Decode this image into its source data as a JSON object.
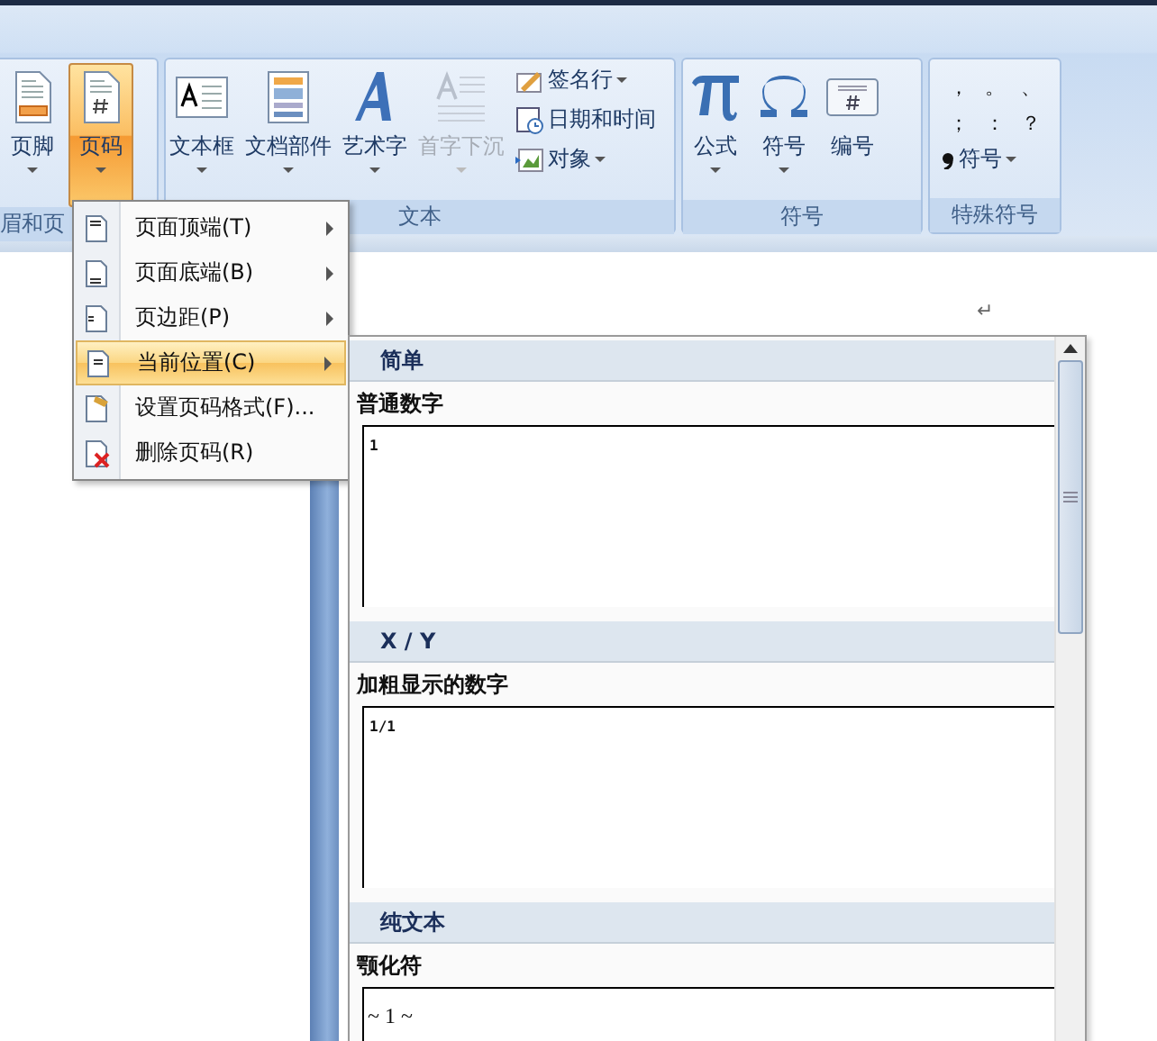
{
  "ribbon": {
    "groups": [
      {
        "label": "眉和页",
        "buttons": [
          {
            "kind": "footer",
            "label": "页脚",
            "dropdown": true,
            "selected": false,
            "disabled": false
          },
          {
            "kind": "page-number",
            "label": "页码",
            "dropdown": true,
            "selected": true,
            "disabled": false
          }
        ]
      },
      {
        "label": "文本",
        "buttons": [
          {
            "kind": "textbox",
            "label": "文本框",
            "dropdown": true,
            "selected": false,
            "disabled": false
          },
          {
            "kind": "quickparts",
            "label": "文档部件",
            "dropdown": true,
            "selected": false,
            "disabled": false
          },
          {
            "kind": "wordart",
            "label": "艺术字",
            "dropdown": true,
            "selected": false,
            "disabled": false
          },
          {
            "kind": "dropcap",
            "label": "首字下沉",
            "dropdown": true,
            "selected": false,
            "disabled": true
          }
        ],
        "small_buttons": [
          {
            "kind": "signature",
            "label": "签名行",
            "dropdown": true
          },
          {
            "kind": "datetime",
            "label": "日期和时间",
            "dropdown": false
          },
          {
            "kind": "object",
            "label": "对象",
            "dropdown": true
          }
        ]
      },
      {
        "label": "符号",
        "buttons": [
          {
            "kind": "equation",
            "label": "公式",
            "dropdown": true,
            "selected": false,
            "disabled": false
          },
          {
            "kind": "symbol",
            "label": "符号",
            "dropdown": true,
            "selected": false,
            "disabled": false
          },
          {
            "kind": "number",
            "label": "编号",
            "dropdown": false,
            "selected": false,
            "disabled": false
          }
        ]
      },
      {
        "label": "特殊符号",
        "symbols": [
          "，",
          "。",
          "、",
          "；",
          "：",
          "？"
        ],
        "symbol_button": {
          "label": "符号",
          "dropdown": true
        }
      }
    ]
  },
  "menu": {
    "items": [
      {
        "kind": "top",
        "label": "页面顶端(T)",
        "submenu": true,
        "selected": false
      },
      {
        "kind": "bottom",
        "label": "页面底端(B)",
        "submenu": true,
        "selected": false
      },
      {
        "kind": "margin",
        "label": "页边距(P)",
        "submenu": true,
        "selected": false
      },
      {
        "kind": "current",
        "label": "当前位置(C)",
        "submenu": true,
        "selected": true
      },
      {
        "kind": "format",
        "label": "设置页码格式(F)...",
        "submenu": false,
        "selected": false
      },
      {
        "kind": "remove",
        "label": "删除页码(R)",
        "submenu": false,
        "selected": false
      }
    ]
  },
  "gallery": {
    "sections": [
      {
        "header": "简单",
        "title": "普通数字",
        "preview": "1",
        "kind": "small"
      },
      {
        "header": "X / Y",
        "title": "加粗显示的数字",
        "preview": "1/1",
        "kind": "small"
      },
      {
        "header": "纯文本",
        "title": "颚化符",
        "preview": "~ 1 ~",
        "kind": "serif"
      }
    ]
  },
  "document": {
    "paragraph_mark": "↵"
  }
}
